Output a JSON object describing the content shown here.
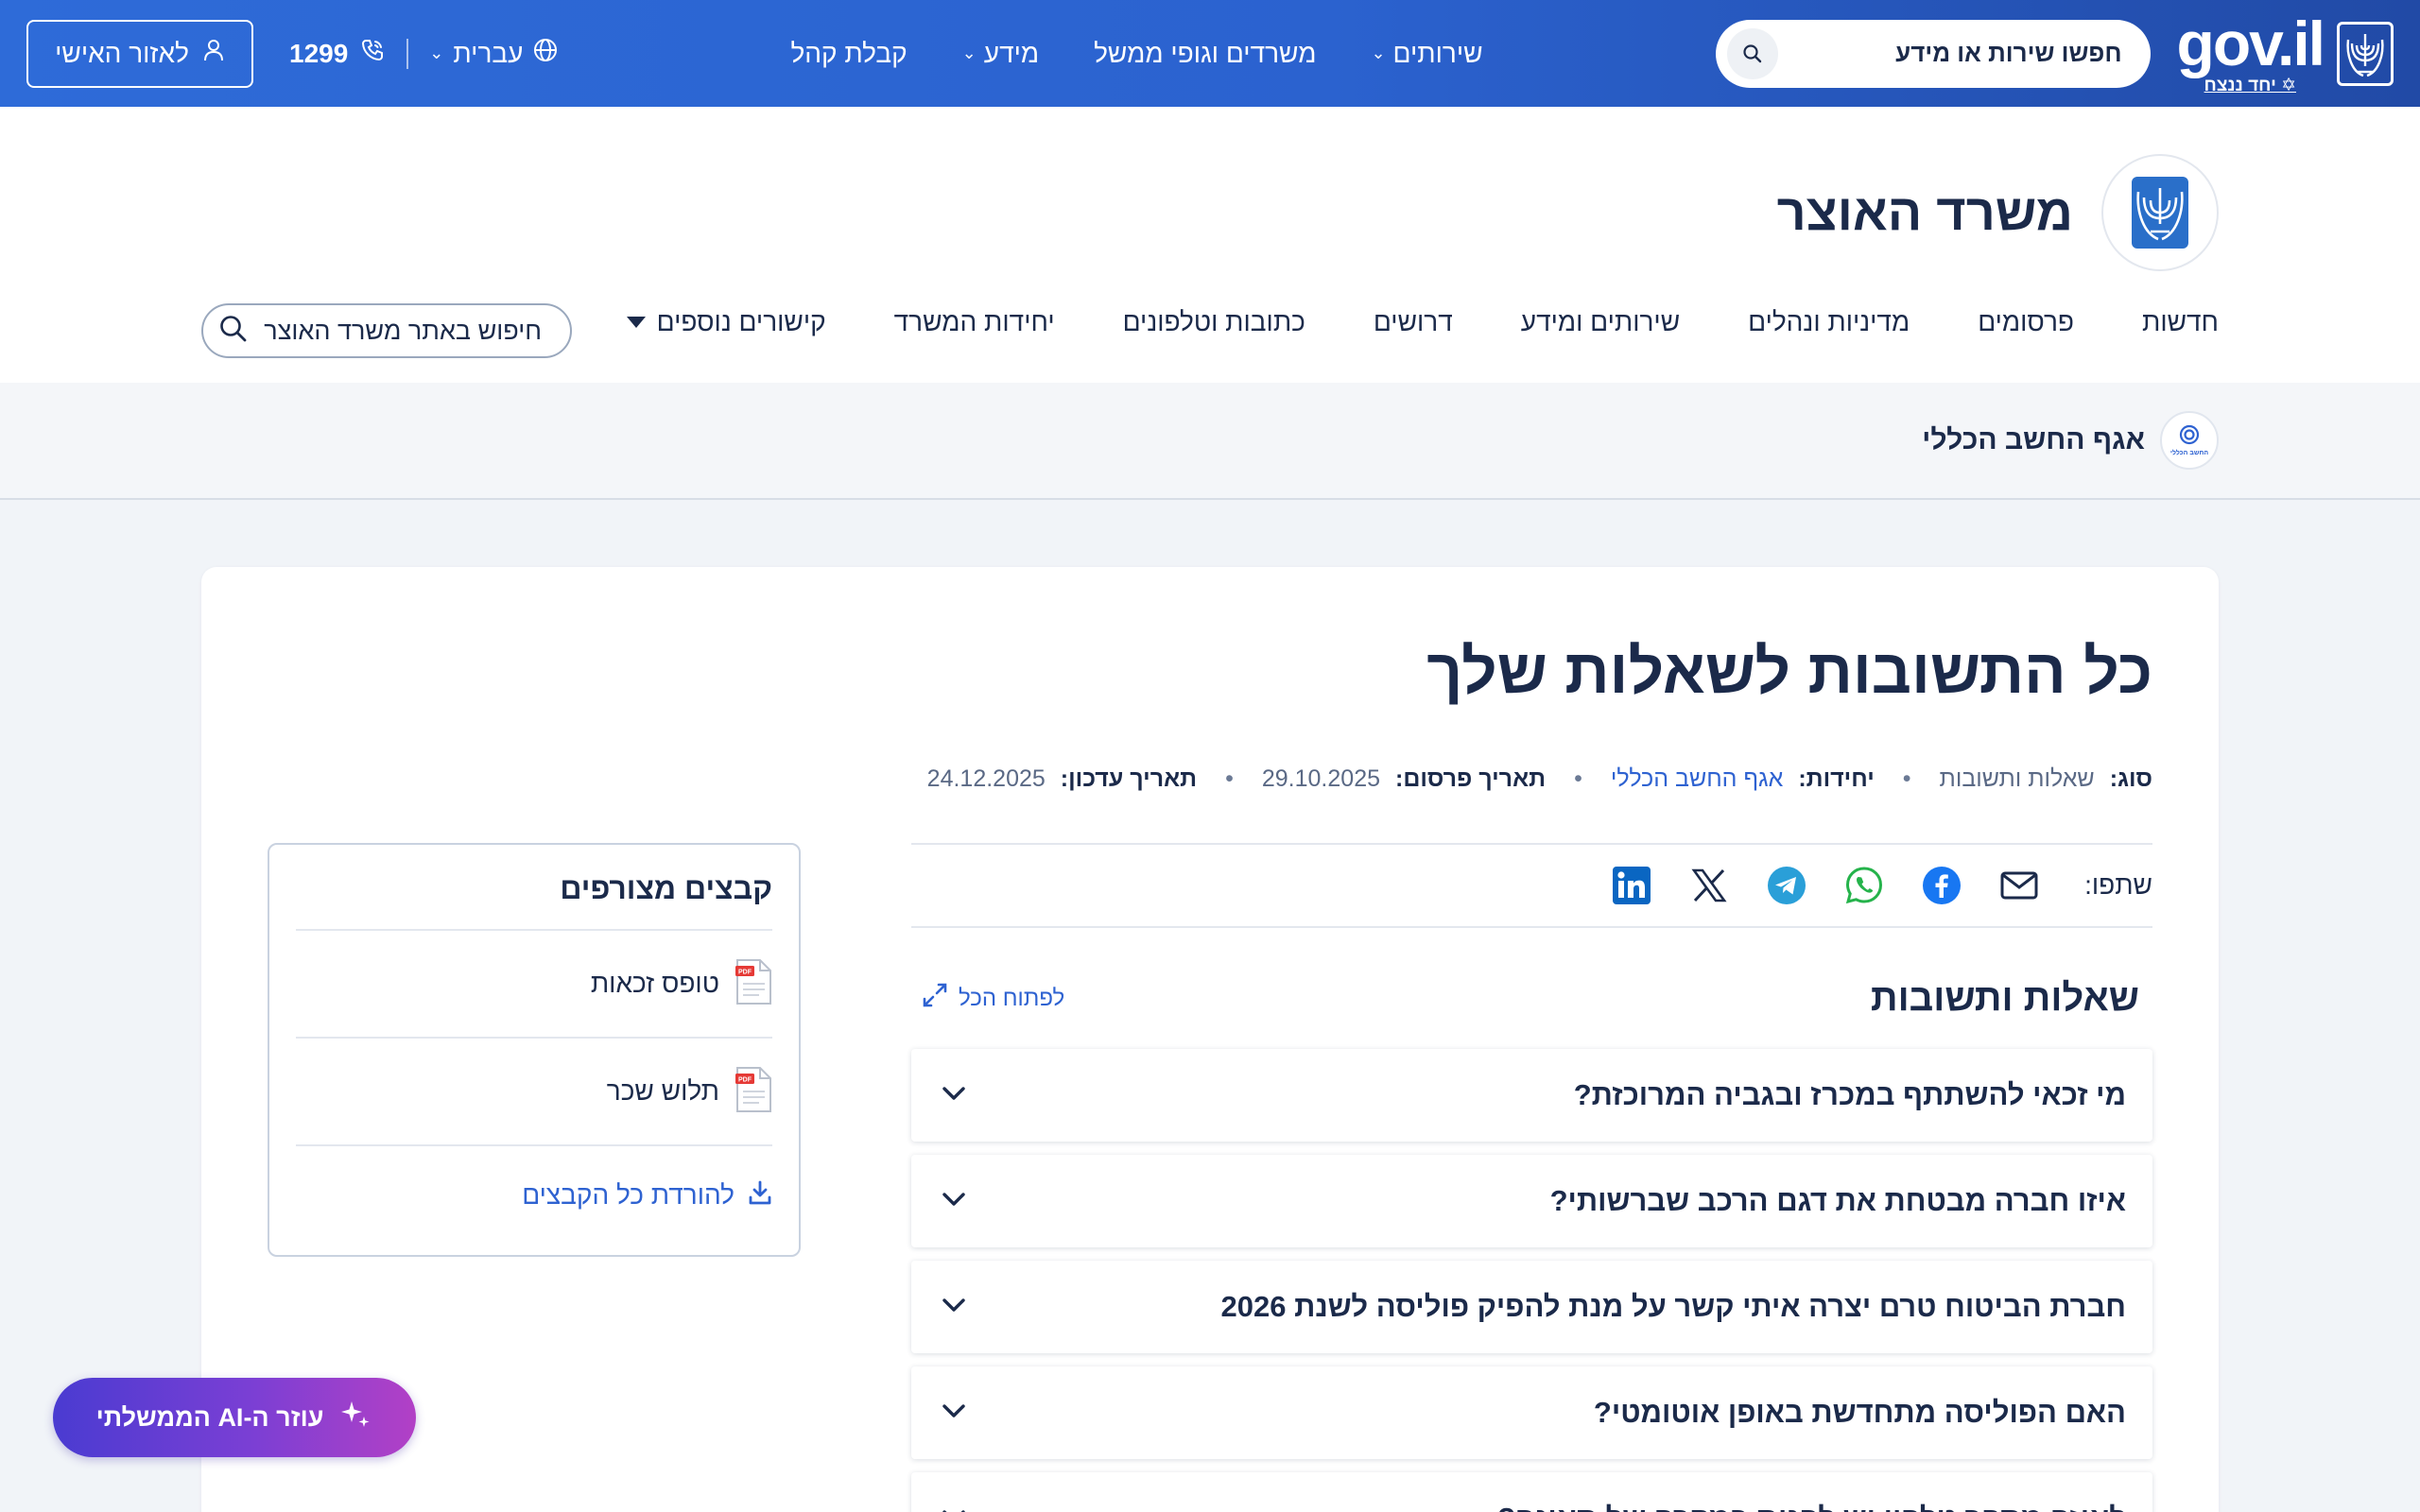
{
  "topbar": {
    "logo_word": "gov.il",
    "logo_tagline": "✡ יחד ננצח",
    "search_placeholder": "חפשו שירות או מידע",
    "nav": [
      {
        "label": "שירותים",
        "has_dropdown": true
      },
      {
        "label": "משרדים וגופי ממשל",
        "has_dropdown": false
      },
      {
        "label": "מידע",
        "has_dropdown": true
      },
      {
        "label": "קבלת קהל",
        "has_dropdown": false
      }
    ],
    "language": "עברית",
    "phone": "1299",
    "personal_area": "לאזור האישי"
  },
  "ministry": {
    "name": "משרד האוצר",
    "nav": [
      "חדשות",
      "פרסומים",
      "מדיניות ונהלים",
      "שירותים ומידע",
      "דרושים",
      "כתובות וטלפונים",
      "יחידות המשרד",
      "קישורים נוספים"
    ],
    "search_placeholder": "חיפוש באתר משרד האוצר"
  },
  "unit": {
    "name": "אגף החשב הכללי",
    "logo_text": "החשב הכללי"
  },
  "article": {
    "title": "כל התשובות לשאלות שלך",
    "meta": {
      "type_label": "סוג:",
      "type_value": "שאלות ותשובות",
      "units_label": "יחידות:",
      "units_value": "אגף החשב הכללי",
      "published_label": "תאריך פרסום:",
      "published_value": "29.10.2025",
      "updated_label": "תאריך עדכון:",
      "updated_value": "24.12.2025"
    },
    "share_label": "שתפו:",
    "share_icons": [
      "mail-icon",
      "facebook-icon",
      "whatsapp-icon",
      "telegram-icon",
      "x-icon",
      "linkedin-icon"
    ]
  },
  "faq": {
    "title": "שאלות ותשובות",
    "open_all": "לפתוח הכל",
    "items": [
      "מי זכאי להשתתף במכרז ובגביה המרוכזת?",
      "איזו חברה מבטחת את דגם הרכב שברשותי?",
      "חברת הביטוח טרם יצרה איתי קשר על מנת להפיק פוליסה לשנת 2026",
      "האם הפוליסה מתחדשת באופן אוטומטי?",
      "לאיזה מספר טלפון יש לפנות במקרה של תאונה?"
    ]
  },
  "attachments": {
    "title": "קבצים מצורפים",
    "files": [
      "טופס זכאות",
      "תלוש שכר"
    ],
    "file_type": "PDF",
    "download_all": "להורדת כל הקבצים"
  },
  "ai_helper": {
    "label": "עוזר ה-AI הממשלתי"
  },
  "colors": {
    "topbar": "#2b62cf",
    "text": "#1b2a4a",
    "link": "#2e62d1",
    "ai_gradient_start": "#4a3bd1",
    "ai_gradient_end": "#b240c6"
  }
}
